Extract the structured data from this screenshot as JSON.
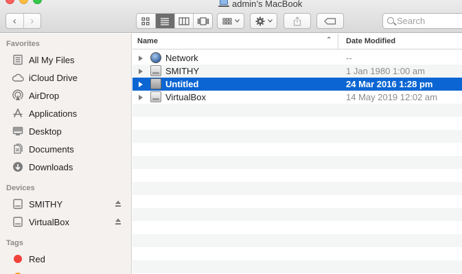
{
  "window": {
    "title": "admin’s MacBook"
  },
  "toolbar": {
    "back_symbol": "‹",
    "forward_symbol": "›",
    "search_placeholder": "Search"
  },
  "sidebar": {
    "favorites_heading": "Favorites",
    "favorites": [
      {
        "label": "All My Files",
        "icon": "all-files-icon"
      },
      {
        "label": "iCloud Drive",
        "icon": "cloud-icon"
      },
      {
        "label": "AirDrop",
        "icon": "airdrop-icon"
      },
      {
        "label": "Applications",
        "icon": "applications-icon"
      },
      {
        "label": "Desktop",
        "icon": "desktop-icon"
      },
      {
        "label": "Documents",
        "icon": "documents-icon"
      },
      {
        "label": "Downloads",
        "icon": "downloads-icon"
      }
    ],
    "devices_heading": "Devices",
    "devices": [
      {
        "label": "SMITHY",
        "icon": "drive-icon"
      },
      {
        "label": "VirtualBox",
        "icon": "drive-icon"
      }
    ],
    "tags_heading": "Tags",
    "tags": [
      {
        "label": "Red",
        "color": "#f0433a"
      },
      {
        "label": "",
        "color": "#f59a23"
      }
    ]
  },
  "list": {
    "columns": {
      "name": "Name",
      "date": "Date Modified"
    },
    "rows": [
      {
        "name": "Network",
        "date": "--",
        "icon": "network-globe-icon"
      },
      {
        "name": "SMITHY",
        "date": "1 Jan 1980 1:00 am",
        "icon": "drive-icon"
      },
      {
        "name": "Untitled",
        "date": "24 Mar 2016 1:28 pm",
        "icon": "disk-icon",
        "selected": true
      },
      {
        "name": "VirtualBox",
        "date": "14 May 2019 12:02 am",
        "icon": "drive-icon"
      }
    ]
  },
  "colors": {
    "selection": "#0b66d3",
    "sidebar_bg": "#f5f1ef",
    "close": "#fc615d",
    "minimize": "#fdbc40",
    "maximize": "#34c84a"
  }
}
